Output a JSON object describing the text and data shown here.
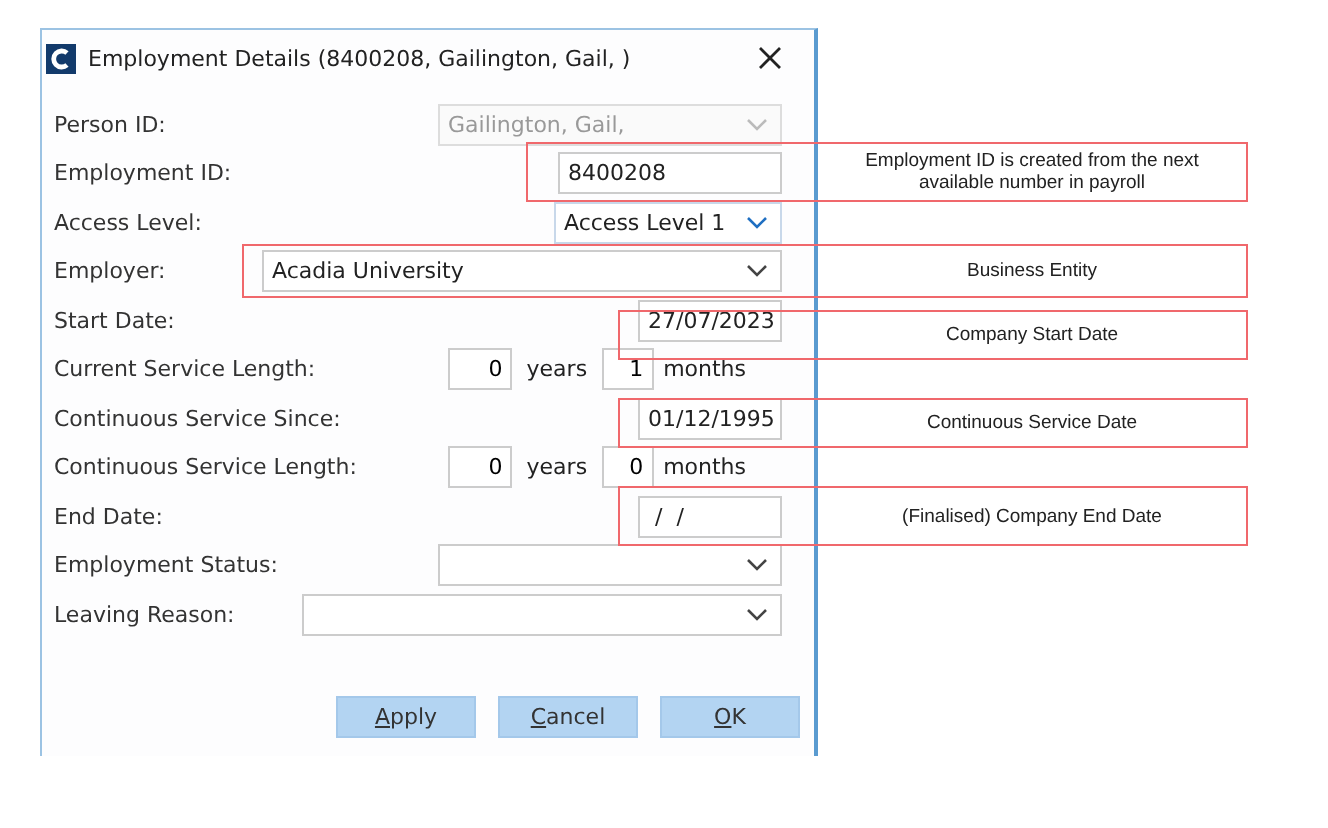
{
  "dialog": {
    "title": "Employment Details (8400208, Gailington, Gail, )",
    "fields": [
      {
        "kind": "combo",
        "label": "Person ID:",
        "value": "Gailington, Gail,",
        "disabled": true,
        "focused": false
      },
      {
        "kind": "text",
        "label": "Employment ID:",
        "value": "8400208"
      },
      {
        "kind": "combo",
        "label": "Access Level:",
        "value": "Access Level 1",
        "disabled": false,
        "focused": true
      },
      {
        "kind": "combo",
        "label": "Employer:",
        "value": "Acadia University",
        "disabled": false,
        "focused": false
      },
      {
        "kind": "date",
        "label": "Start Date:",
        "value": "27/07/2023"
      },
      {
        "kind": "duration",
        "label": "Current Service Length:",
        "years": "0",
        "years_unit": "years",
        "months": "1",
        "months_unit": "months"
      },
      {
        "kind": "date",
        "label": "Continuous Service Since:",
        "value": "01/12/1995"
      },
      {
        "kind": "duration",
        "label": "Continuous Service Length:",
        "years": "0",
        "years_unit": "years",
        "months": "0",
        "months_unit": "months"
      },
      {
        "kind": "date",
        "label": "End Date:",
        "value": " /  /"
      },
      {
        "kind": "combo",
        "label": "Employment Status:",
        "disabled": false,
        "focused": false
      },
      {
        "kind": "combo",
        "label": "Leaving Reason:",
        "disabled": false,
        "focused": false
      }
    ],
    "buttons": [
      {
        "accel": "A",
        "rest": "pply"
      },
      {
        "accel": "C",
        "rest": "ancel"
      },
      {
        "accel": "O",
        "rest": "K"
      }
    ]
  },
  "callouts": [
    {
      "text": "Employment ID is created from  the next available number in payroll"
    },
    {
      "text": "Business Entity"
    },
    {
      "text": "Company Start Date"
    },
    {
      "text": "Continuous Service Date"
    },
    {
      "text": "(Finalised) Company End Date"
    }
  ]
}
